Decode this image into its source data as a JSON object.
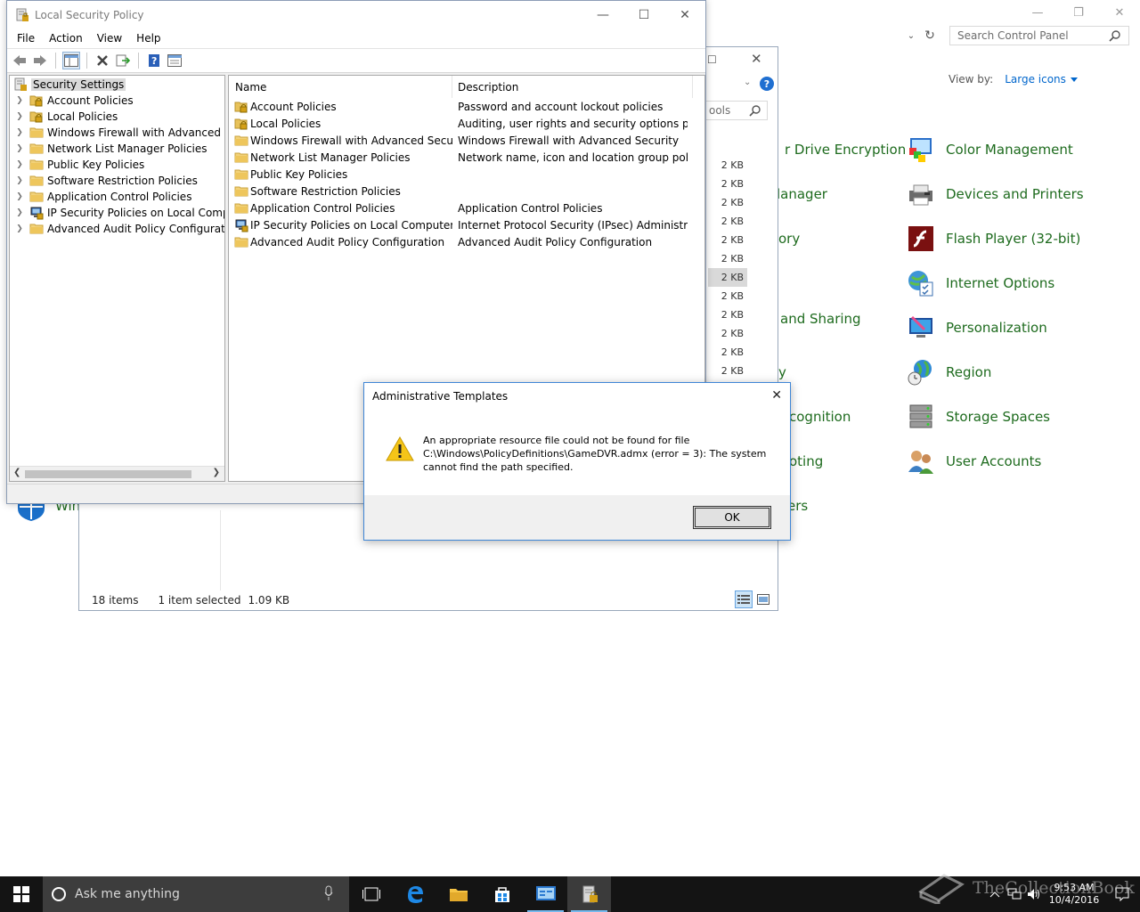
{
  "control_panel": {
    "search_placeholder": "Search Control Panel",
    "view_by_label": "View by:",
    "view_by_value": "Large icons",
    "items": [
      {
        "label": "Color Management",
        "icon": "color-management-icon"
      },
      {
        "label": "Devices and Printers",
        "icon": "printer-icon"
      },
      {
        "label": "Flash Player (32-bit)",
        "icon": "flash-icon"
      },
      {
        "label": "Internet Options",
        "icon": "internet-options-icon"
      },
      {
        "label": "Personalization",
        "icon": "personalization-icon"
      },
      {
        "label": "Region",
        "icon": "globe-clock-icon"
      },
      {
        "label": "Storage Spaces",
        "icon": "storage-icon"
      },
      {
        "label": "User Accounts",
        "icon": "users-icon"
      }
    ],
    "left_items_partial": [
      "r Drive Encryption",
      "lanager",
      "ory",
      "and Sharing",
      "y",
      "cognition",
      "oting",
      "ers"
    ],
    "left_bottom_partial": "Win"
  },
  "explorer": {
    "search_partial": "ools",
    "sizes": [
      "2 KB",
      "2 KB",
      "2 KB",
      "2 KB",
      "2 KB",
      "2 KB",
      "2 KB",
      "2 KB",
      "2 KB",
      "2 KB",
      "2 KB",
      "2 KB"
    ],
    "selected_size_index": 6,
    "status_items": "18 items",
    "status_selected": "1 item selected",
    "status_size": "1.09 KB"
  },
  "lsp": {
    "title": "Local Security Policy",
    "menu": [
      "File",
      "Action",
      "View",
      "Help"
    ],
    "tree_root": "Security Settings",
    "tree": [
      {
        "label": "Account Policies",
        "icon": "lock-folder"
      },
      {
        "label": "Local Policies",
        "icon": "lock-folder"
      },
      {
        "label": "Windows Firewall with Advanced Security",
        "icon": "folder"
      },
      {
        "label": "Network List Manager Policies",
        "icon": "folder"
      },
      {
        "label": "Public Key Policies",
        "icon": "folder"
      },
      {
        "label": "Software Restriction Policies",
        "icon": "folder"
      },
      {
        "label": "Application Control Policies",
        "icon": "folder"
      },
      {
        "label": "IP Security Policies on Local Computer",
        "icon": "ipsec"
      },
      {
        "label": "Advanced Audit Policy Configuration",
        "icon": "folder"
      }
    ],
    "list_headers": {
      "name": "Name",
      "description": "Description"
    },
    "list": [
      {
        "name": "Account Policies",
        "description": "Password and account lockout policies",
        "icon": "lock-folder"
      },
      {
        "name": "Local Policies",
        "description": "Auditing, user rights and security options polici...",
        "icon": "lock-folder"
      },
      {
        "name": "Windows Firewall with Advanced Security",
        "description": "Windows Firewall with Advanced Security",
        "icon": "folder"
      },
      {
        "name": "Network List Manager Policies",
        "description": "Network name, icon and location group policies.",
        "icon": "folder"
      },
      {
        "name": "Public Key Policies",
        "description": "",
        "icon": "folder"
      },
      {
        "name": "Software Restriction Policies",
        "description": "",
        "icon": "folder"
      },
      {
        "name": "Application Control Policies",
        "description": "Application Control Policies",
        "icon": "folder"
      },
      {
        "name": "IP Security Policies on Local Computer",
        "description": "Internet Protocol Security (IPsec) Administratio...",
        "icon": "ipsec"
      },
      {
        "name": "Advanced Audit Policy Configuration",
        "description": "Advanced Audit Policy Configuration",
        "icon": "folder"
      }
    ]
  },
  "dialog": {
    "title": "Administrative Templates",
    "message_line1": "An appropriate resource file could not be found for file",
    "message_line2": "C:\\Windows\\PolicyDefinitions\\GameDVR.admx (error = 3): The system",
    "message_line3": "cannot find the path specified.",
    "ok_label": "OK"
  },
  "taskbar": {
    "search_placeholder": "Ask me anything",
    "time": "9:53 AM",
    "date": "10/4/2016"
  },
  "watermark": "TheCollectionBook",
  "colors": {
    "accent": "#0066cc",
    "cp_link": "#1e6b1e",
    "taskbar": "#141414"
  }
}
